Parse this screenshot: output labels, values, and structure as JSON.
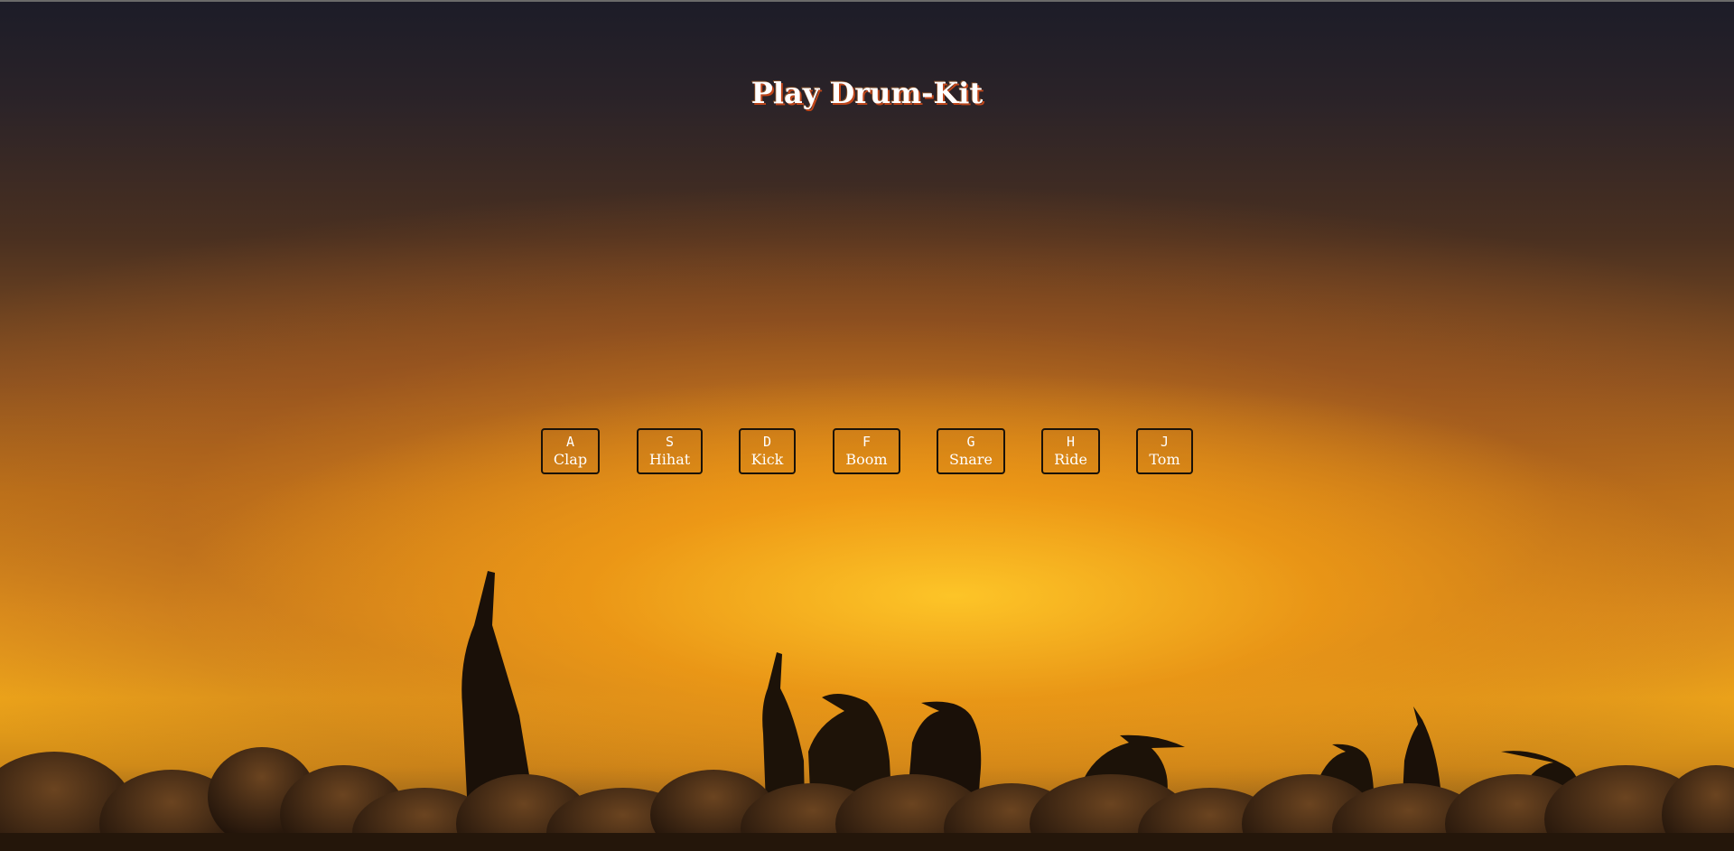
{
  "page": {
    "title": "Play Drum-Kit"
  },
  "keys": [
    {
      "key": "A",
      "sound": "Clap"
    },
    {
      "key": "S",
      "sound": "Hihat"
    },
    {
      "key": "D",
      "sound": "Kick"
    },
    {
      "key": "F",
      "sound": "Boom"
    },
    {
      "key": "G",
      "sound": "Snare"
    },
    {
      "key": "H",
      "sound": "Ride"
    },
    {
      "key": "J",
      "sound": "Tom"
    }
  ],
  "colors": {
    "title_text": "#ffffff",
    "title_shadow": "#c0461a",
    "key_border": "#1a1208",
    "key_text": "#ffffff",
    "sky_top": "#1c1c28",
    "sky_glow": "#f0a81a"
  },
  "background": {
    "description_icon": "penguin-silhouettes-sunset-image"
  }
}
